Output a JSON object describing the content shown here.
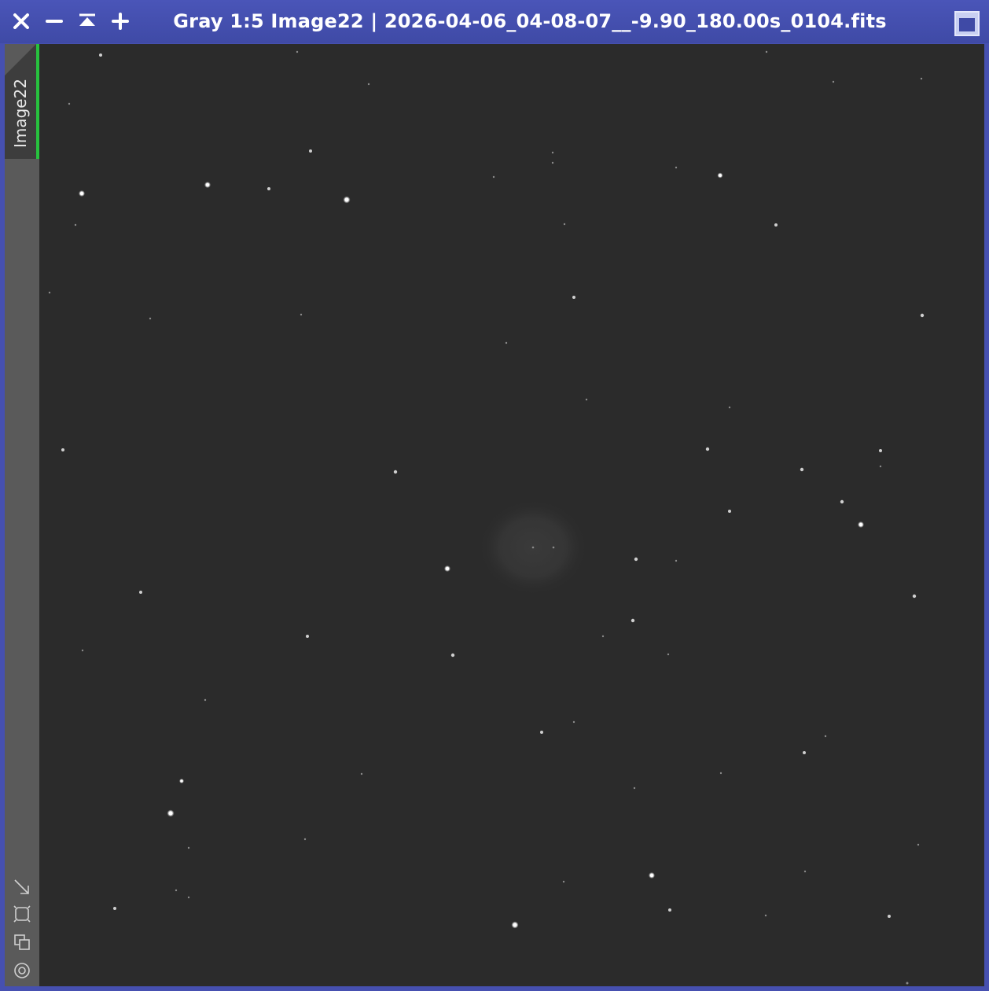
{
  "window": {
    "title": "Gray 1:5 Image22 | 2026-04-06_04-08-07__-9.90_180.00s_0104.fits",
    "accent_color": "#4650b0",
    "tab_label": "Image22",
    "tab_indicator_color": "#27c13e"
  },
  "titlebar_buttons": [
    {
      "name": "close-icon"
    },
    {
      "name": "minimize-icon"
    },
    {
      "name": "shade-icon"
    },
    {
      "name": "zoom-in-icon"
    }
  ],
  "side_tools": [
    {
      "name": "fit-view-icon"
    },
    {
      "name": "zoom-extents-icon"
    },
    {
      "name": "clone-view-icon"
    },
    {
      "name": "center-target-icon"
    }
  ],
  "image": {
    "description_colors": {
      "background": "#2b2b2b",
      "star": "#ffffff"
    }
  }
}
